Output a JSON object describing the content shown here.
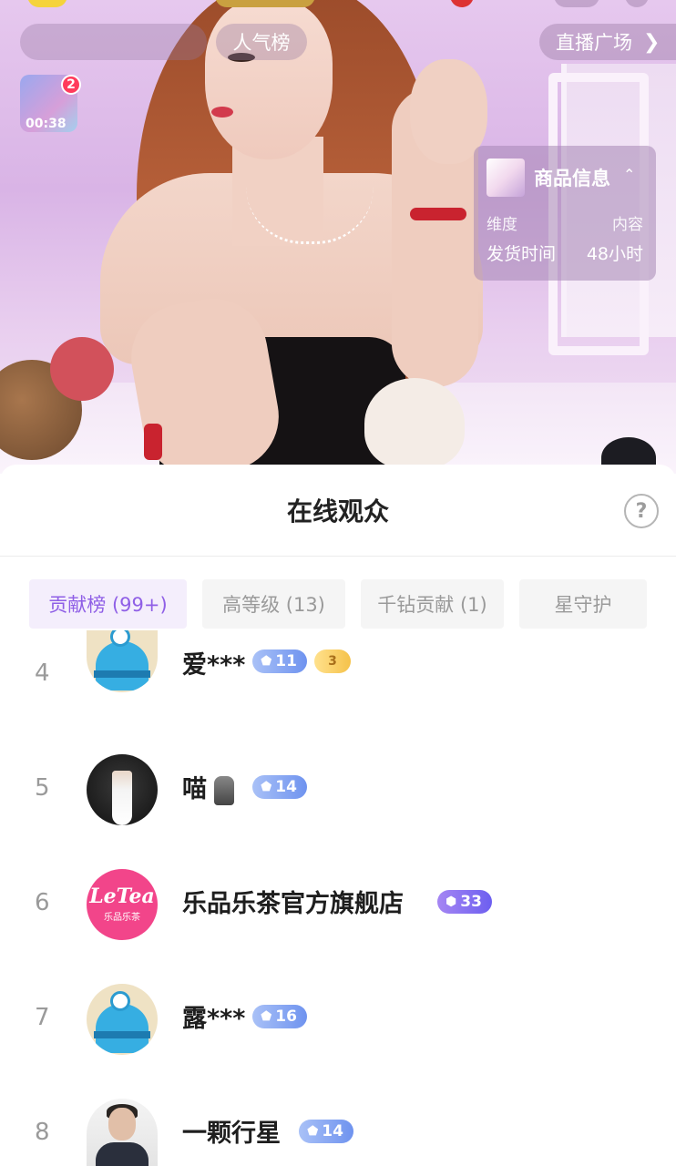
{
  "overlay": {
    "rank_pill": "人气榜",
    "plaza_button": "直播广场",
    "mini_video": {
      "badge": "2",
      "time": "00:38"
    }
  },
  "product_card": {
    "title": "商品信息",
    "header_left": "维度",
    "header_right": "内容",
    "row_label": "发货时间",
    "row_value": "48小时"
  },
  "sheet": {
    "title": "在线观众",
    "help_icon": "?",
    "tabs": [
      {
        "label": "贡献榜 (99+)",
        "active": true
      },
      {
        "label": "高等级 (13)",
        "active": false
      },
      {
        "label": "千钻贡献 (1)",
        "active": false
      },
      {
        "label": "星守护",
        "active": false
      }
    ],
    "viewers": [
      {
        "rank": "4",
        "name": "爱***",
        "level": "11",
        "fan_level": "3",
        "avatar": "monster-avatar"
      },
      {
        "rank": "5",
        "name": "喵",
        "level": "14",
        "avatar": "photo-avatar",
        "extra_icon": "microphone-icon"
      },
      {
        "rank": "6",
        "name": "乐品乐茶官方旗舰店",
        "level": "33",
        "avatar": "letea-logo",
        "logo_text": "LeTea",
        "logo_sub": "乐品乐茶"
      },
      {
        "rank": "7",
        "name": "露***",
        "level": "16",
        "avatar": "monster-avatar"
      },
      {
        "rank": "8",
        "name": "一颗行星",
        "level": "14",
        "avatar": "man-avatar"
      }
    ]
  }
}
